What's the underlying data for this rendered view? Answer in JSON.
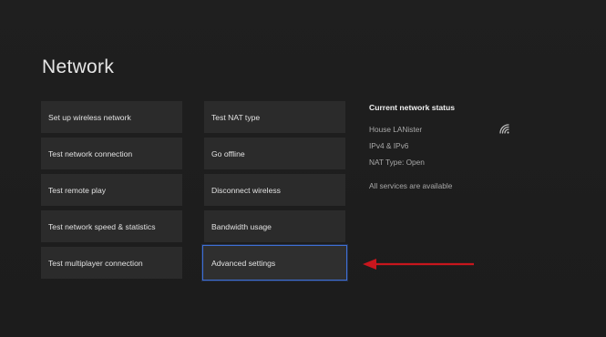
{
  "page": {
    "title": "Network"
  },
  "menu": {
    "left": [
      {
        "label": "Set up wireless network"
      },
      {
        "label": "Test network connection"
      },
      {
        "label": "Test remote play"
      },
      {
        "label": "Test network speed & statistics"
      },
      {
        "label": "Test multiplayer connection"
      }
    ],
    "right": [
      {
        "label": "Test NAT type"
      },
      {
        "label": "Go offline"
      },
      {
        "label": "Disconnect wireless"
      },
      {
        "label": "Bandwidth usage"
      },
      {
        "label": "Advanced settings",
        "selected": true
      }
    ]
  },
  "status": {
    "title": "Current network status",
    "network_name": "House LANister",
    "ip_version": "IPv4 & IPv6",
    "nat_type": "NAT Type: Open",
    "services": "All services are available",
    "signal_icon": "wifi-signal-icon"
  },
  "annotation": {
    "arrow_color": "#c8161d",
    "points_to": "Advanced settings"
  },
  "colors": {
    "background": "#1e1e1e",
    "tile": "#2b2b2b",
    "selection_border": "#3f6fd6",
    "annotation_arrow": "#c8161d"
  }
}
